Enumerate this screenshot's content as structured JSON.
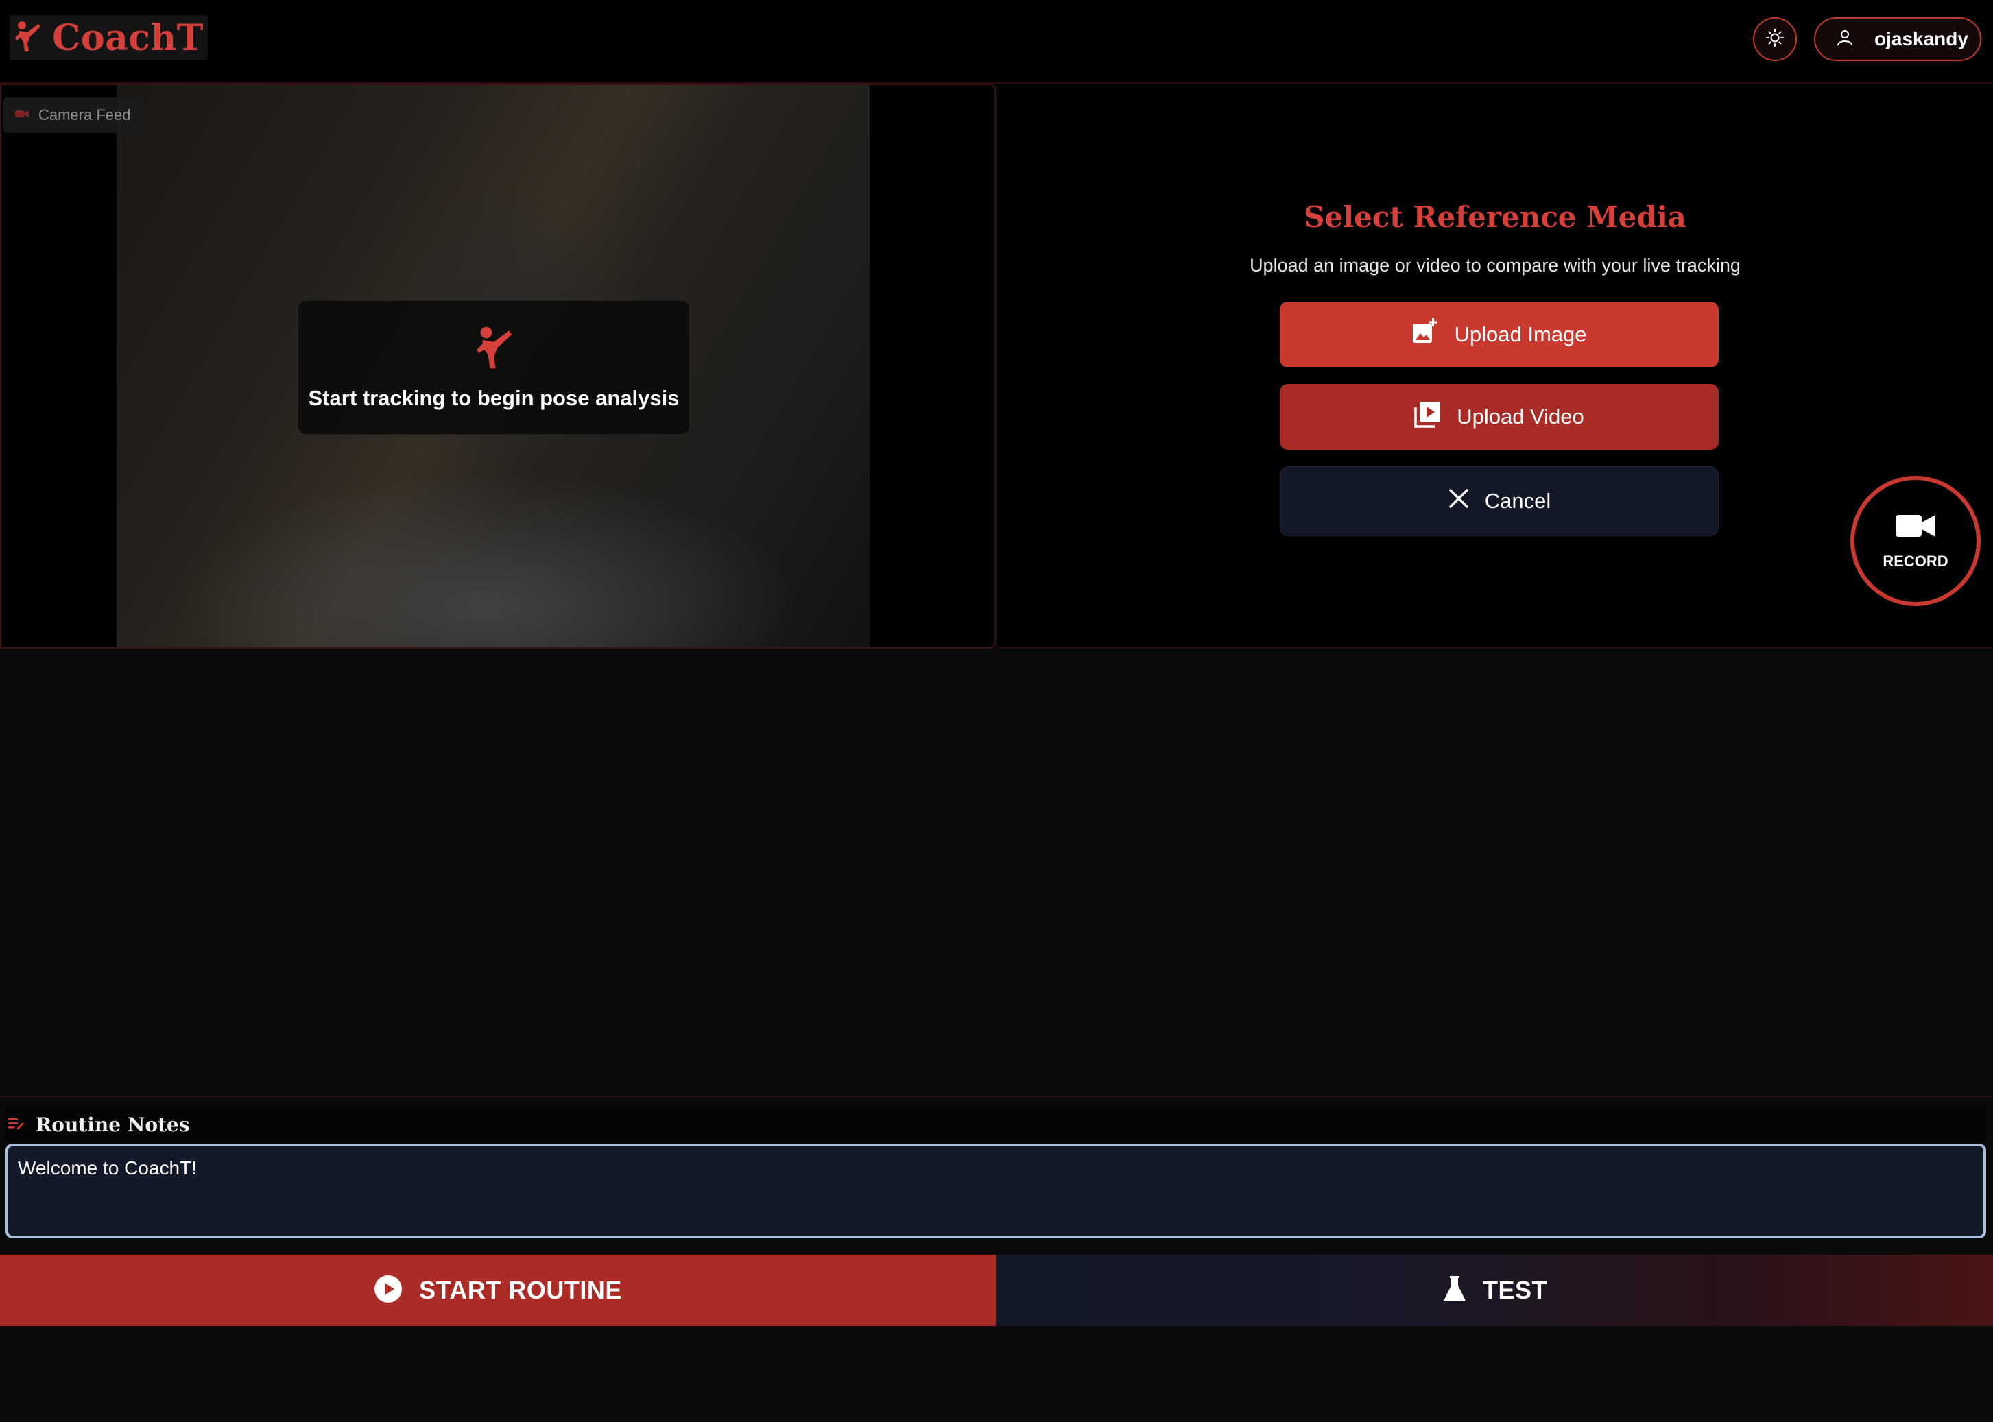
{
  "header": {
    "app_name": "CoachT",
    "username": "ojaskandy"
  },
  "camera": {
    "badge_label": "Camera Feed",
    "overlay_message": "Start tracking to begin pose analysis"
  },
  "reference": {
    "title": "Select Reference Media",
    "subtitle": "Upload an image or video to compare with your live tracking",
    "upload_image_label": "Upload Image",
    "upload_video_label": "Upload Video",
    "cancel_label": "Cancel",
    "record_label": "RECORD"
  },
  "notes": {
    "title": "Routine Notes",
    "value": "Welcome to CoachT!"
  },
  "actions": {
    "start_label": "START ROUTINE",
    "test_label": "TEST"
  },
  "colors": {
    "accent": "#d6403a",
    "button_red": "#c9392f",
    "button_dark_red": "#a82b26",
    "navy": "#121826"
  },
  "icons": {
    "logo": "martial-arts-kick-icon",
    "theme": "sun-icon",
    "user": "user-icon",
    "camera_badge": "video-camera-icon",
    "upload_image": "add-photo-icon",
    "upload_video": "video-library-icon",
    "cancel": "close-icon",
    "record": "video-camera-icon",
    "notes": "notes-icon",
    "start": "play-circle-icon",
    "test": "flask-icon"
  }
}
